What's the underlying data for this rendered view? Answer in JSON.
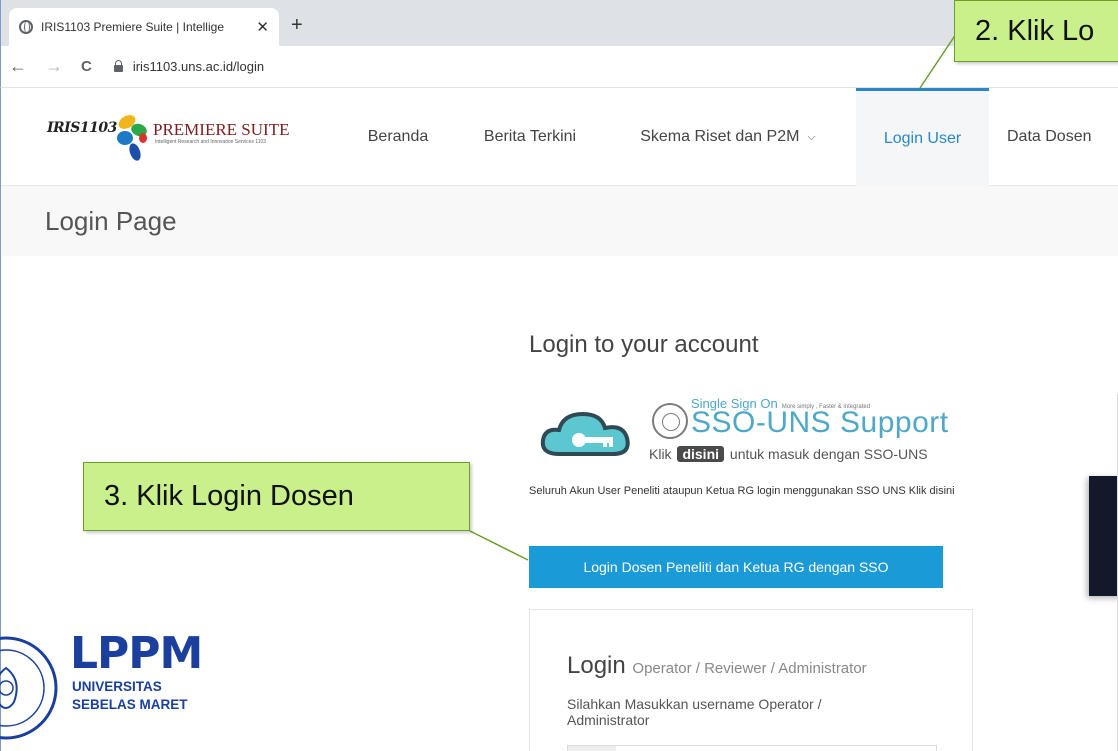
{
  "browser": {
    "tab_title": "IRIS1103 Premiere Suite | Intellige",
    "tab_close": "✕",
    "new_tab": "+",
    "back": "←",
    "forward": "→",
    "reload": "C",
    "url": "iris1103.uns.ac.id/login"
  },
  "site": {
    "logo": {
      "iris": "IRIS1103",
      "premiere": "PREMIERE SUITE",
      "tagline": "Intelligent Research and Innovation Services 1103"
    },
    "nav": [
      {
        "label": "Beranda"
      },
      {
        "label": "Berita Terkini"
      },
      {
        "label": "Skema Riset dan P2M",
        "caret": "⌵"
      },
      {
        "label": "Login User",
        "active": true
      },
      {
        "label": "Data Dosen"
      }
    ],
    "page_title": "Login Page"
  },
  "content": {
    "heading": "Login to your account",
    "sso": {
      "small_title": "Single Sign On",
      "tiny_text": "More simply , Faster & integrated",
      "big_title": "SSO-UNS Support",
      "klik": "Klik",
      "disini": "disini",
      "rest": "untuk masuk dengan SSO-UNS"
    },
    "description": "Seluruh Akun User Peneliti ataupun Ketua RG login menggunakan SSO UNS Klik disini",
    "sso_button": "Login Dosen Peneliti dan Ketua RG dengan SSO",
    "card": {
      "title": "Login",
      "subtitle": "Operator / Reviewer / Administrator",
      "hint": "Silahkan Masukkan username Operator / Administrator"
    }
  },
  "lppm": {
    "name": "LPPM",
    "line1": "UNIVERSITAS",
    "line2": "SEBELAS MARET"
  },
  "callouts": {
    "step2": "2. Klik Lo",
    "step3": "3. Klik Login Dosen"
  },
  "colors": {
    "accent": "#2a88c8",
    "button": "#1a9ad6",
    "callout": "#c9f08a",
    "lppm": "#1a3f9c"
  }
}
